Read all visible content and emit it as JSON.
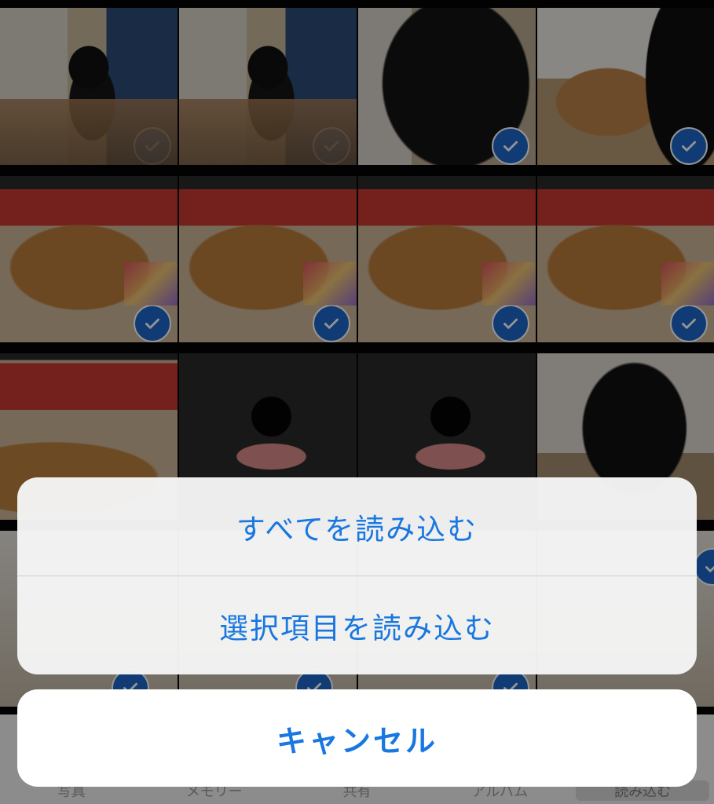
{
  "action_sheet": {
    "import_all_label": "すべてを読み込む",
    "import_selected_label": "選択項目を読み込む",
    "cancel_label": "キャンセル"
  },
  "tab_bar": {
    "items": [
      {
        "label": "写真"
      },
      {
        "label": "メモリー"
      },
      {
        "label": "共有"
      },
      {
        "label": "アルバム"
      },
      {
        "label": "読み込む"
      }
    ],
    "active_index": 4
  },
  "photos": [
    {
      "subject": "dog-in-room",
      "selected": true
    },
    {
      "subject": "dog-in-room",
      "selected": true
    },
    {
      "subject": "dog-closeup",
      "selected": true
    },
    {
      "subject": "dog-and-cat",
      "selected": true
    },
    {
      "subject": "cat",
      "selected": true
    },
    {
      "subject": "cat",
      "selected": true
    },
    {
      "subject": "cat",
      "selected": true
    },
    {
      "subject": "cat",
      "selected": true
    },
    {
      "subject": "cat-box",
      "selected": true
    },
    {
      "subject": "dog-face",
      "selected": true
    },
    {
      "subject": "dog-face",
      "selected": true
    },
    {
      "subject": "dog-far",
      "selected": true
    }
  ],
  "colors": {
    "accent": "#1877e0",
    "checkmark_badge": "#1c66c9",
    "sheet_background": "#f5f5f5"
  }
}
